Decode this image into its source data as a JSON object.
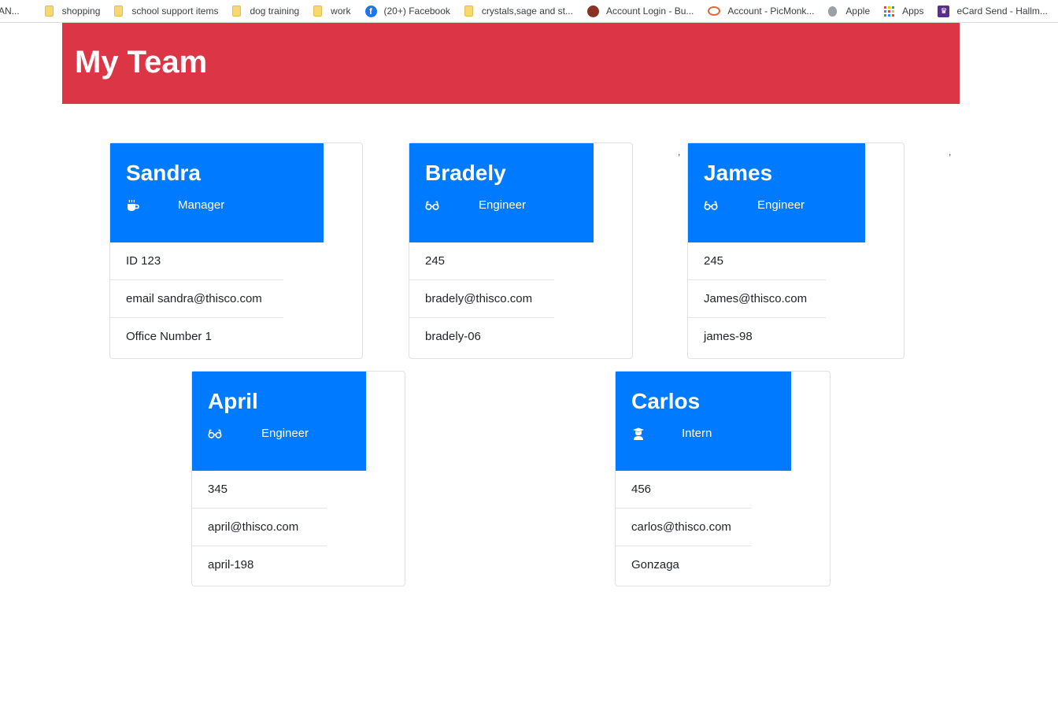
{
  "bookmarks": [
    {
      "label": "AN...",
      "icon": "none"
    },
    {
      "label": "shopping",
      "icon": "folder-icon"
    },
    {
      "label": "school support items",
      "icon": "folder-icon"
    },
    {
      "label": "dog training",
      "icon": "folder-icon"
    },
    {
      "label": "work",
      "icon": "folder-icon"
    },
    {
      "label": "(20+) Facebook",
      "icon": "facebook-icon"
    },
    {
      "label": "crystals,sage and st...",
      "icon": "folder-icon"
    },
    {
      "label": "Account Login - Bu...",
      "icon": "site-icon"
    },
    {
      "label": "Account - PicMonk...",
      "icon": "picmonkey-icon"
    },
    {
      "label": "Apple",
      "icon": "apple-icon"
    },
    {
      "label": "Apps",
      "icon": "apps-grid-icon"
    },
    {
      "label": "eCard Send - Hallm...",
      "icon": "hallmark-crown-icon"
    }
  ],
  "header": {
    "title": "My Team",
    "color": "#dc3545"
  },
  "accent": "#007bff",
  "team": [
    {
      "name": "Sandra",
      "role": "Manager",
      "icon": "coffee-icon",
      "details": [
        "ID 123",
        "email sandra@thisco.com",
        "Office Number 1"
      ]
    },
    {
      "name": "Bradely",
      "role": "Engineer",
      "icon": "glasses-icon",
      "details": [
        "245",
        "bradely@thisco.com",
        "bradely-06"
      ]
    },
    {
      "name": "James",
      "role": "Engineer",
      "icon": "glasses-icon",
      "details": [
        "245",
        "James@thisco.com",
        "james-98"
      ]
    },
    {
      "name": "April",
      "role": "Engineer",
      "icon": "glasses-icon",
      "details": [
        "345",
        "april@thisco.com",
        "april-198"
      ]
    },
    {
      "name": "Carlos",
      "role": "Intern",
      "icon": "graduate-icon",
      "details": [
        "456",
        "carlos@thisco.com",
        "Gonzaga"
      ]
    }
  ],
  "stray_marks": [
    ",",
    ","
  ]
}
